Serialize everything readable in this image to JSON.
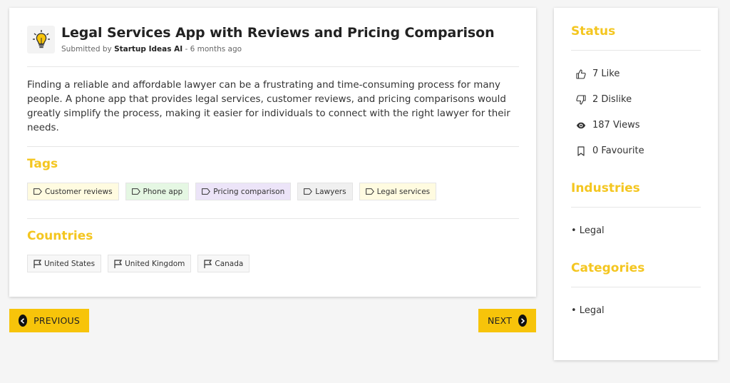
{
  "post": {
    "title": "Legal Services App with Reviews and Pricing Comparison",
    "submitted_prefix": "Submitted by",
    "author": "Startup Ideas AI",
    "separator": " - ",
    "time_ago": "6 months ago",
    "logo_icon": "lightbulb-icon",
    "description": "Finding a reliable and affordable lawyer can be a frustrating and time-consuming process for many people. A phone app that provides legal services, customer reviews, and pricing comparisons would greatly simplify the process, making it easier for individuals to connect with the right lawyer for their needs."
  },
  "tags": {
    "title": "Tags",
    "items": [
      {
        "label": "Customer reviews",
        "bg": "#fffbe0",
        "icon": "tag-icon"
      },
      {
        "label": "Phone app",
        "bg": "#e5f7e3",
        "icon": "tag-icon"
      },
      {
        "label": "Pricing comparison",
        "bg": "#ece4f8",
        "icon": "tag-icon"
      },
      {
        "label": "Lawyers",
        "bg": "#f0f0f0",
        "icon": "tag-icon"
      },
      {
        "label": "Legal services",
        "bg": "#fffbe0",
        "icon": "tag-icon"
      }
    ]
  },
  "countries": {
    "title": "Countries",
    "items": [
      {
        "label": "United States",
        "icon": "flag-icon"
      },
      {
        "label": "United Kingdom",
        "icon": "flag-icon"
      },
      {
        "label": "Canada",
        "icon": "flag-icon"
      }
    ]
  },
  "navigation": {
    "previous_label": "PREVIOUS",
    "next_label": "NEXT"
  },
  "sidebar": {
    "status_title": "Status",
    "stats": [
      {
        "icon": "thumbs-up-icon",
        "text": "7 Like"
      },
      {
        "icon": "thumbs-down-icon",
        "text": "2 Dislike"
      },
      {
        "icon": "eye-icon",
        "text": "187 Views"
      },
      {
        "icon": "bookmark-icon",
        "text": "0 Favourite"
      }
    ],
    "industries_title": "Industries",
    "industries": [
      "• Legal"
    ],
    "categories_title": "Categories",
    "categories": [
      "• Legal"
    ]
  },
  "colors": {
    "accent": "#f4c620",
    "button": "#f7c40a"
  }
}
